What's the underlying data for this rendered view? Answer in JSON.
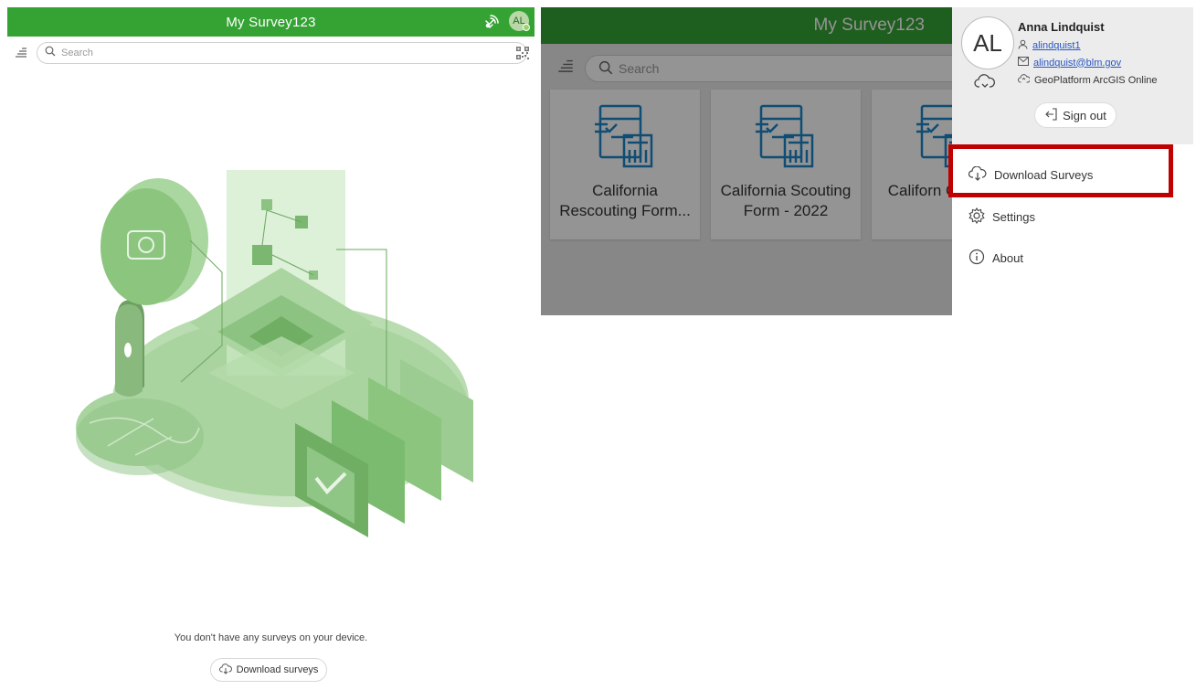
{
  "colors": {
    "brand_green": "#35a334",
    "right_header_green": "#2f7a2b",
    "illustration_green": "#7bbf73",
    "highlight_red": "#c00000",
    "link_blue": "#2956c2"
  },
  "left": {
    "title": "My Survey123",
    "avatar_initials": "AL",
    "search_placeholder": "Search",
    "empty_message": "You don't have any surveys on your device.",
    "download_button_label": "Download surveys",
    "icons": [
      "menu-icon",
      "search-icon",
      "qr-code-icon",
      "gps-signal-icon",
      "cloud-download-icon"
    ]
  },
  "right": {
    "title": "My Survey123",
    "search_placeholder": "Search",
    "cards": [
      {
        "label": "California Rescouting Form..."
      },
      {
        "label": "California Scouting Form - 2022"
      },
      {
        "label": "Californ Collectio"
      }
    ],
    "profile": {
      "initials": "AL",
      "name": "Anna Lindquist",
      "username": "alindquist1",
      "email": "alindquist@blm.gov",
      "portal": "GeoPlatform ArcGIS Online",
      "sign_out_label": "Sign out"
    },
    "menu": [
      {
        "label": "Download Surveys",
        "icon": "cloud-download-icon"
      },
      {
        "label": "Settings",
        "icon": "gear-icon"
      },
      {
        "label": "About",
        "icon": "info-icon"
      }
    ]
  }
}
